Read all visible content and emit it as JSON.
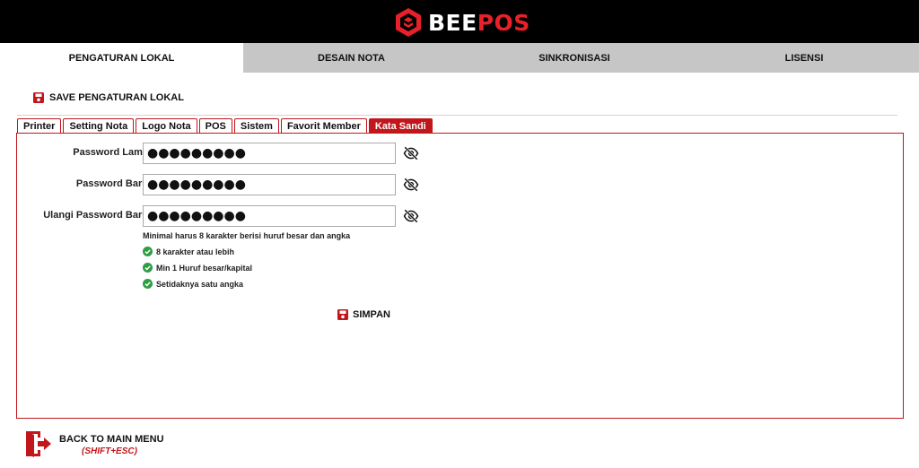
{
  "app": {
    "logo_bee": "BEE",
    "logo_pos": "POS",
    "brand_color": "#e8202a"
  },
  "main_tabs": [
    {
      "label": "PENGATURAN LOKAL",
      "active": true
    },
    {
      "label": "DESAIN NOTA",
      "active": false
    },
    {
      "label": "SINKRONISASI",
      "active": false
    },
    {
      "label": "LISENSI",
      "active": false
    }
  ],
  "save_local": {
    "label": "SAVE PENGATURAN LOKAL",
    "icon": "floppy-disk-icon"
  },
  "sub_tabs": [
    {
      "label": "Printer",
      "active": false
    },
    {
      "label": "Setting Nota",
      "active": false
    },
    {
      "label": "Logo Nota",
      "active": false
    },
    {
      "label": "POS",
      "active": false
    },
    {
      "label": "Sistem",
      "active": false
    },
    {
      "label": "Favorit Member",
      "active": false
    },
    {
      "label": "Kata Sandi",
      "active": true
    }
  ],
  "form": {
    "fields": [
      {
        "label": "Password Lama",
        "value": "●●●●●●●●●",
        "icon": "eye-slash-icon"
      },
      {
        "label": "Password Baru",
        "value": "●●●●●●●●●",
        "icon": "eye-slash-icon"
      },
      {
        "label": "Ulangi Password Baru",
        "value": "●●●●●●●●●",
        "icon": "eye-slash-icon"
      }
    ],
    "hint": "Minimal harus 8 karakter berisi huruf besar dan angka",
    "rules": [
      {
        "text": "8 karakter atau lebih",
        "status": "ok"
      },
      {
        "text": "Min 1 Huruf besar/kapital",
        "status": "ok"
      },
      {
        "text": "Setidaknya satu angka",
        "status": "ok"
      }
    ],
    "rule_ok_color": "#2e9e44",
    "submit_label": "SIMPAN"
  },
  "footer": {
    "back_label": "BACK TO MAIN MENU",
    "shortcut": "(SHIFT+ESC)",
    "icon": "exit-door-icon"
  }
}
